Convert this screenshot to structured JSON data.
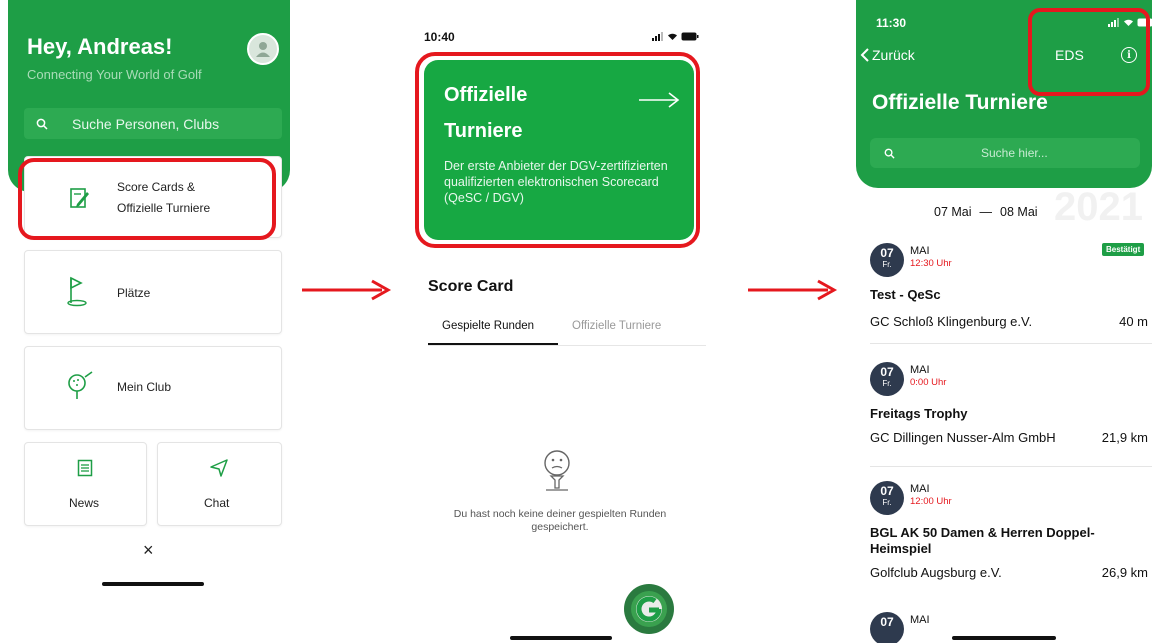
{
  "screen1": {
    "greeting": "Hey, Andreas!",
    "subtitle": "Connecting Your World of Golf",
    "search_placeholder": "Suche Personen, Clubs",
    "tiles": {
      "scorecards_line1": "Score Cards &",
      "scorecards_line2": "Offizielle Turniere",
      "plaetze": "Plätze",
      "mein_club": "Mein Club",
      "news": "News",
      "chat": "Chat"
    },
    "close_symbol": "×"
  },
  "screen2": {
    "status_time": "10:40",
    "card_title_line1": "Offizielle",
    "card_title_line2": "Turniere",
    "card_description": "Der erste Anbieter der DGV-zertifizierten qualifizierten elektronischen Scorecard (QeSC / DGV)",
    "section_title": "Score Card",
    "tabs": [
      "Gespielte Runden",
      "Offizielle Turniere"
    ],
    "empty_message": "Du hast noch keine deiner gespielten Runden gespeichert."
  },
  "screen3": {
    "status_time": "11:30",
    "back_label": "Zurück",
    "eds_label": "EDS",
    "info_symbol": "i",
    "title": "Offizielle Turniere",
    "search_placeholder": "Suche hier...",
    "year_watermark": "2021",
    "date_from": "07 Mai",
    "date_sep": "—",
    "date_to": "08 Mai",
    "events": [
      {
        "day": "07",
        "weekday": "Fr.",
        "month": "MAI",
        "time": "12:30 Uhr",
        "status": "Bestätigt",
        "name": "Test - QeSc",
        "club": "GC Schloß Klingenburg e.V.",
        "distance": "40 m"
      },
      {
        "day": "07",
        "weekday": "Fr.",
        "month": "MAI",
        "time": "0:00 Uhr",
        "status": "",
        "name": "Freitags Trophy",
        "club": "GC Dillingen Nusser-Alm GmbH",
        "distance": "21,9 km"
      },
      {
        "day": "07",
        "weekday": "Fr.",
        "month": "MAI",
        "time": "12:00 Uhr",
        "status": "",
        "name": "BGL AK 50 Damen & Herren Doppel-Heimspiel",
        "club": "Golfclub Augsburg e.V.",
        "distance": "26,9 km"
      },
      {
        "day": "07",
        "month": "MAI"
      }
    ]
  },
  "colors": {
    "brand_green": "#1e9e46",
    "highlight_red": "#e5181e",
    "badge_navy": "#2e3a4e"
  }
}
